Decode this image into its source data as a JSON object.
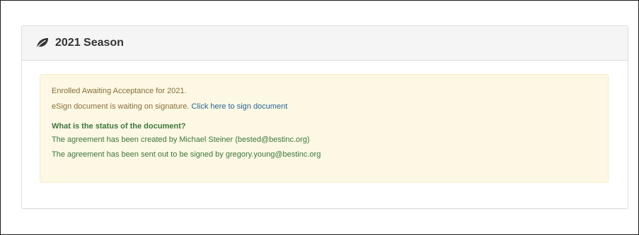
{
  "panel": {
    "title": "2021 Season",
    "icon": "leaf-icon"
  },
  "alert": {
    "enrollment_text": "Enrolled Awaiting Acceptance for 2021.",
    "esign_text": "eSign document is waiting on signature. ",
    "sign_link_label": "Click here to sign document",
    "status_heading": "What is the status of the document?",
    "status_lines": [
      "The agreement has been created by Michael Steiner (bested@bestinc.org)",
      "The agreement has been sent out to be signed by gregory.young@bestinc.org"
    ]
  },
  "colors": {
    "alert_background": "#fcf8e3",
    "alert_text": "#8a6d3b",
    "status_text": "#3c763d",
    "link": "#2a6496"
  }
}
